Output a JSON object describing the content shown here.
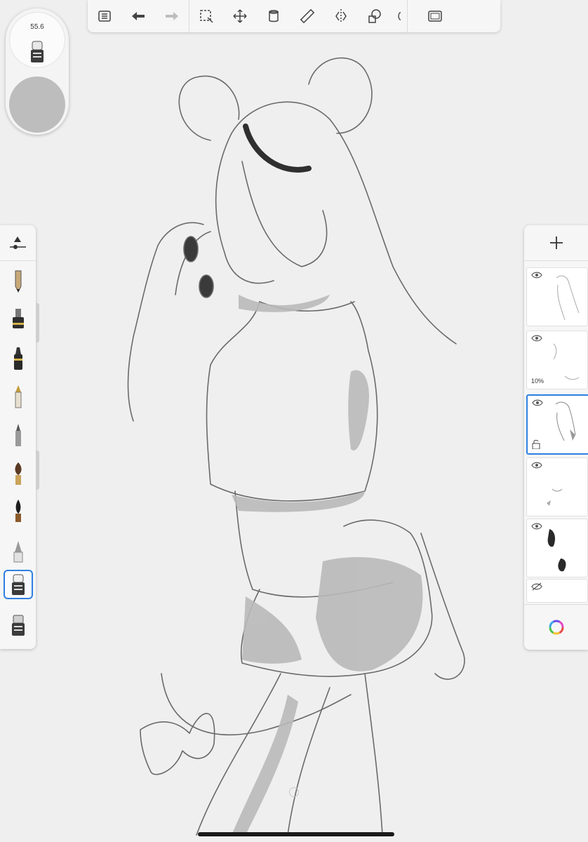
{
  "app": {
    "accent": "#2f7fe0"
  },
  "toolbar": {
    "buttons": [
      {
        "icon": "gallery-list-icon"
      },
      {
        "icon": "undo-icon"
      },
      {
        "icon": "redo-icon"
      },
      {
        "icon": "selection-icon"
      },
      {
        "icon": "transform-icon"
      },
      {
        "icon": "fill-bucket-icon"
      },
      {
        "icon": "ruler-icon"
      },
      {
        "icon": "symmetry-icon"
      },
      {
        "icon": "shapes-icon"
      },
      {
        "icon": "fullscreen-icon"
      }
    ]
  },
  "brush_puck": {
    "size_value": "55.6",
    "current_color": "#bdbdbd"
  },
  "brush_palette": {
    "items": [
      {
        "icon": "pencil-icon"
      },
      {
        "icon": "marker-icon"
      },
      {
        "icon": "felt-pen-icon"
      },
      {
        "icon": "fountain-pen-icon"
      },
      {
        "icon": "ballpoint-icon"
      },
      {
        "icon": "paintbrush-icon"
      },
      {
        "icon": "ink-brush-icon"
      },
      {
        "icon": "airbrush-icon"
      },
      {
        "icon": "soft-eraser-icon",
        "selected": true
      },
      {
        "icon": "hard-eraser-icon"
      }
    ]
  },
  "layers_panel": {
    "layers": [
      {
        "visible": true,
        "opacity": "",
        "locked": false,
        "active": false
      },
      {
        "visible": true,
        "opacity": "10%",
        "locked": false,
        "active": false
      },
      {
        "visible": true,
        "opacity": "",
        "locked": true,
        "active": true
      },
      {
        "visible": true,
        "opacity": "",
        "locked": false,
        "active": false
      },
      {
        "visible": true,
        "opacity": "",
        "locked": false,
        "active": false
      },
      {
        "visible": false,
        "opacity": "",
        "locked": false,
        "active": false
      }
    ]
  }
}
